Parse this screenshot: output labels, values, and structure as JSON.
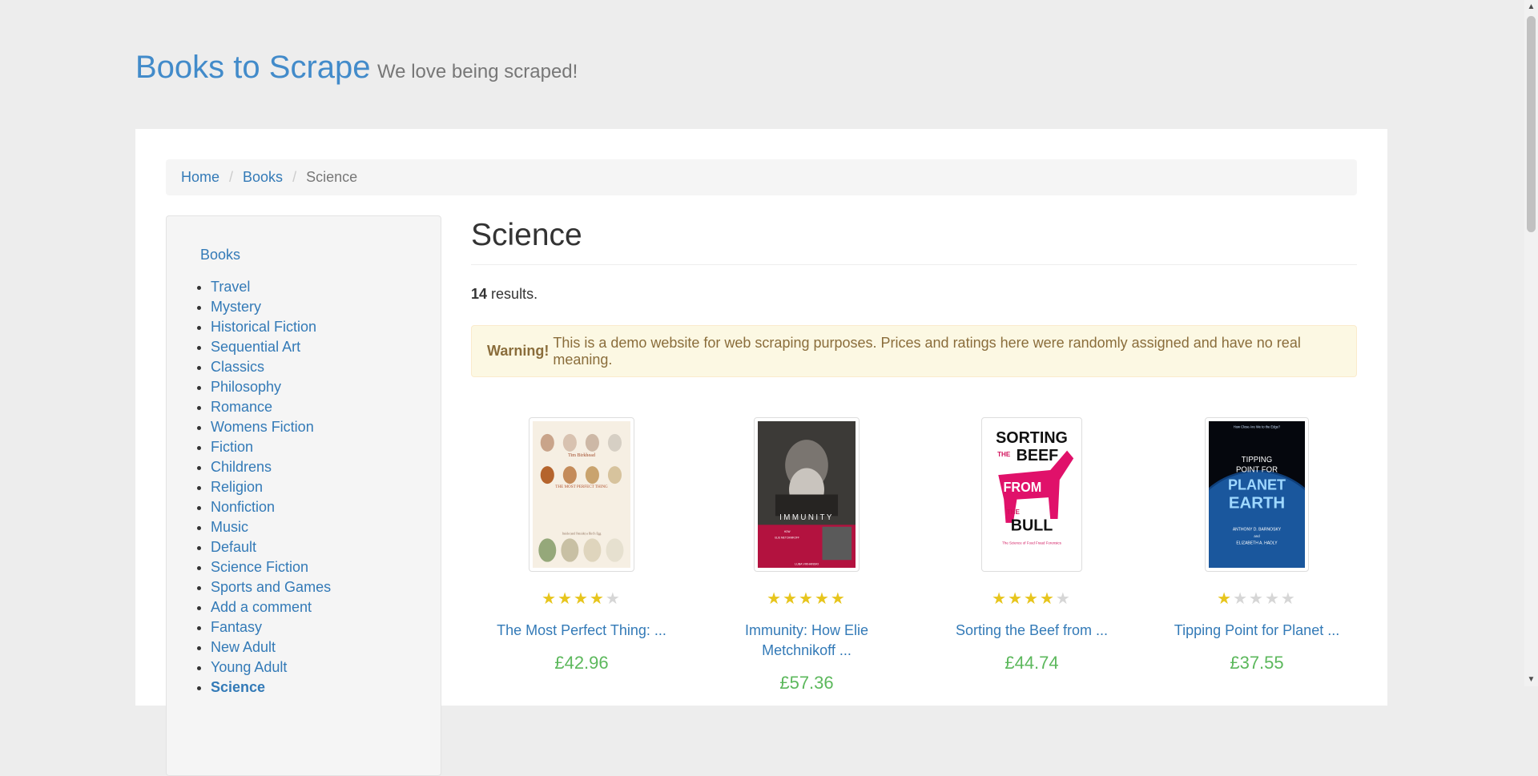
{
  "header": {
    "brand": "Books to Scrape",
    "tagline": "We love being scraped!"
  },
  "breadcrumb": {
    "home": "Home",
    "books": "Books",
    "current": "Science"
  },
  "sidebar": {
    "root": "Books",
    "categories": [
      "Travel",
      "Mystery",
      "Historical Fiction",
      "Sequential Art",
      "Classics",
      "Philosophy",
      "Romance",
      "Womens Fiction",
      "Fiction",
      "Childrens",
      "Religion",
      "Nonfiction",
      "Music",
      "Default",
      "Science Fiction",
      "Sports and Games",
      "Add a comment",
      "Fantasy",
      "New Adult",
      "Young Adult",
      "Science"
    ]
  },
  "main": {
    "title": "Science",
    "results_count": "14",
    "results_suffix": "results.",
    "alert_strong": "Warning!",
    "alert_text": "This is a demo website for web scraping purposes. Prices and ratings here were randomly assigned and have no real meaning."
  },
  "products": [
    {
      "title_line1": "The Most Perfect Thing: ...",
      "title_line2": "",
      "rating": 4,
      "price": "£42.96",
      "cover": {
        "kind": "eggs",
        "author": "Tim Birkhead",
        "title": "THE MOST PERFECT THING",
        "subtitle": "Inside (and Outside) a Bird's Egg"
      }
    },
    {
      "title_line1": "Immunity: How Elie",
      "title_line2": "Metchnikoff ...",
      "rating": 5,
      "price": "£57.36",
      "cover": {
        "kind": "portrait",
        "title": "IMMUNITY",
        "subtitle": "HOW ELIE METCHNIKOFF CHANGED THE COURSE OF MODERN MEDICINE",
        "author": "LUBA VIKHANSKI"
      }
    },
    {
      "title_line1": "Sorting the Beef from ...",
      "title_line2": "",
      "rating": 4,
      "price": "£44.74",
      "cover": {
        "kind": "horse",
        "line1": "SORTING",
        "line2": "THE",
        "line3": "BEEF",
        "line4": "FROM",
        "line5": "THE",
        "line6": "BULL",
        "subtitle": "The Science of Food Fraud Forensics"
      }
    },
    {
      "title_line1": "Tipping Point for Planet ...",
      "title_line2": "",
      "rating": 1,
      "price": "£37.55",
      "cover": {
        "kind": "earth",
        "tag": "How Close Are We to the Edge?",
        "line1": "TIPPING",
        "line2": "POINT FOR",
        "line3": "PLANET",
        "line4": "EARTH",
        "authors": "ANTHONY D. BARNOSKY and ELIZABETH A. HADLY"
      }
    }
  ],
  "colors": {
    "link": "#337ab7",
    "brand": "#428bca",
    "price": "#5cb85c",
    "star": "#e7c51d",
    "alert_bg": "#fcf8e3"
  }
}
